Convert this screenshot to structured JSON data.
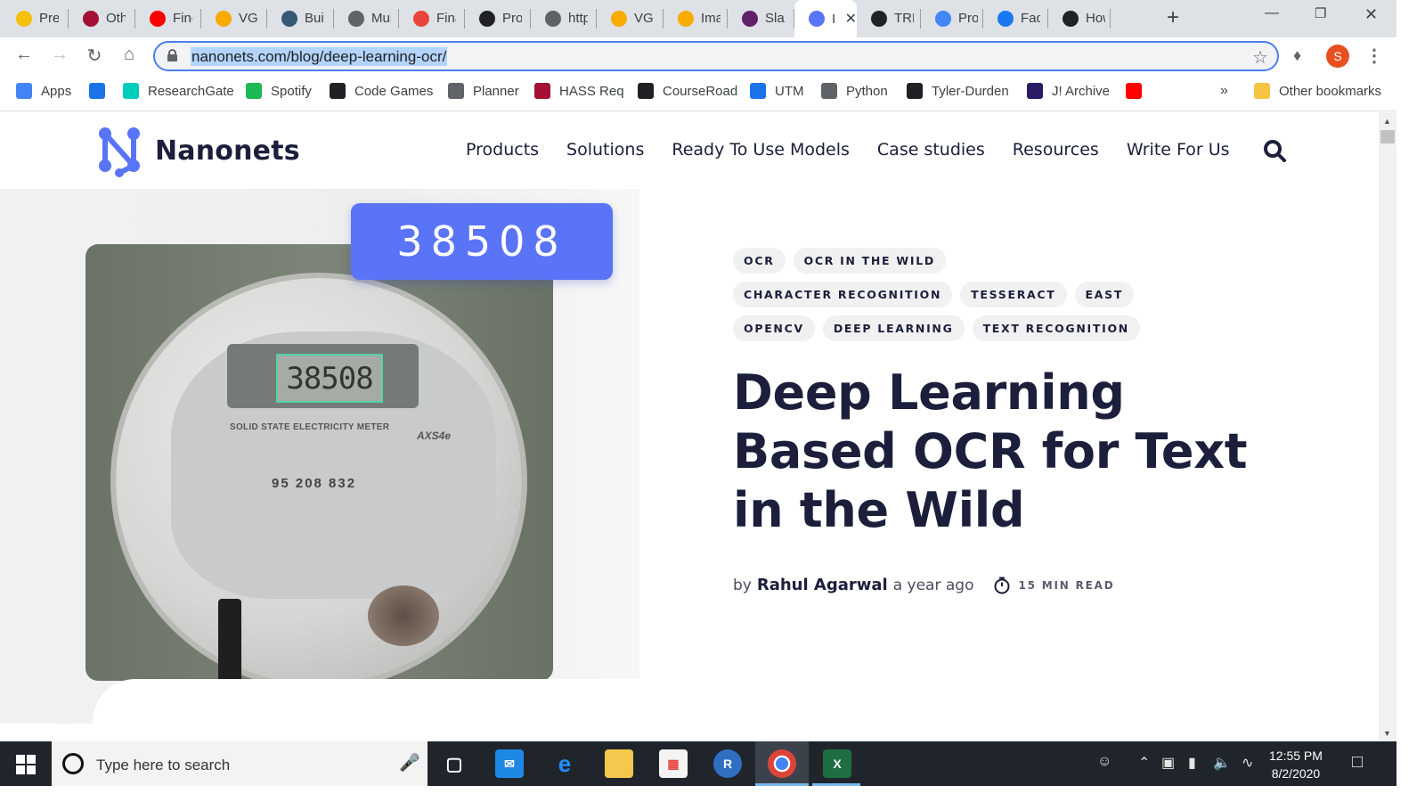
{
  "browser": {
    "tabs": [
      {
        "title": "Prep",
        "icon": "lightbulb-icon",
        "color": "#f4c20d"
      },
      {
        "title": "Other",
        "icon": "harvard-icon",
        "color": "#a41034"
      },
      {
        "title": "Fine",
        "icon": "youtube-icon",
        "color": "#ff0000"
      },
      {
        "title": "VGG",
        "icon": "colab-icon",
        "color": "#f9ab00"
      },
      {
        "title": "Build",
        "icon": "tds-icon",
        "color": "#355876"
      },
      {
        "title": "Mult",
        "icon": "globe-icon",
        "color": "#5f6368"
      },
      {
        "title": "Final",
        "icon": "wheel-icon",
        "color": "#e8453c"
      },
      {
        "title": "Proc",
        "icon": "d-icon",
        "color": "#202124"
      },
      {
        "title": "http",
        "icon": "globe-icon",
        "color": "#5f6368"
      },
      {
        "title": "VGG",
        "icon": "colab-icon",
        "color": "#f9ab00"
      },
      {
        "title": "Imag",
        "icon": "colab-icon",
        "color": "#f9ab00"
      },
      {
        "title": "Slack",
        "icon": "slack-icon",
        "color": "#611f69"
      },
      {
        "title": "I",
        "icon": "nanonets-icon",
        "color": "#5a74f7",
        "active": true
      },
      {
        "title": "TRE",
        "icon": "github-icon",
        "color": "#202124"
      },
      {
        "title": "Proj",
        "icon": "docs-icon",
        "color": "#4285f4"
      },
      {
        "title": "Face",
        "icon": "facebook-icon",
        "color": "#1877f2"
      },
      {
        "title": "How",
        "icon": "github-icon",
        "color": "#202124"
      }
    ],
    "url": "nanonets.com/blog/deep-learning-ocr/",
    "profile_initial": "S",
    "bookmarks": [
      {
        "label": "Apps",
        "icon": "apps-grid-icon",
        "color": "#4285f4"
      },
      {
        "label": "",
        "icon": "star-bookmark-icon",
        "color": "#1a73e8"
      },
      {
        "label": "ResearchGate",
        "icon": "researchgate-icon",
        "color": "#00ccbb"
      },
      {
        "label": "Spotify",
        "icon": "spotify-icon",
        "color": "#1db954"
      },
      {
        "label": "Code Games",
        "icon": "github-icon",
        "color": "#202124"
      },
      {
        "label": "Planner",
        "icon": "globe-icon",
        "color": "#5f6368"
      },
      {
        "label": "HASS Req",
        "icon": "harvard-icon",
        "color": "#a41034"
      },
      {
        "label": "CourseRoad",
        "icon": "checkbox-icon",
        "color": "#202124"
      },
      {
        "label": "UTM",
        "icon": "cloud-icon",
        "color": "#1a73e8"
      },
      {
        "label": "Python",
        "icon": "globe-icon",
        "color": "#5f6368"
      },
      {
        "label": "Tyler-Durden",
        "icon": "github-icon",
        "color": "#202124"
      },
      {
        "label": "J! Archive",
        "icon": "jarchive-icon",
        "color": "#2b1a66"
      },
      {
        "label": "",
        "icon": "youtube-icon",
        "color": "#ff0000"
      }
    ],
    "overflow": "»",
    "other_bookmarks": "Other bookmarks"
  },
  "site": {
    "brand": "Nanonets",
    "nav": [
      "Products",
      "Solutions",
      "Ready To Use Models",
      "Case studies",
      "Resources",
      "Write For Us"
    ],
    "accent": "#5a74f7",
    "text_color": "#1b1f3b"
  },
  "hero": {
    "badge_number": "38508",
    "lcd_reading": "38508",
    "meter_label": "SOLID STATE ELECTRICITY METER",
    "meter_model": "AXS4e",
    "meter_serial": "95 208 832"
  },
  "article": {
    "tags": [
      [
        "OCR",
        "OCR IN THE WILD"
      ],
      [
        "CHARACTER RECOGNITION",
        "TESSERACT",
        "EAST"
      ],
      [
        "OPENCV",
        "DEEP LEARNING",
        "TEXT RECOGNITION"
      ]
    ],
    "title_lines": [
      "Deep Learning",
      "Based OCR for Text",
      "in the Wild"
    ],
    "by": "by",
    "author": "Rahul Agarwal",
    "posted": "a year ago",
    "read_time": "15 MIN READ"
  },
  "taskbar": {
    "search_placeholder": "Type here to search",
    "time": "12:55 PM",
    "date": "8/2/2020"
  }
}
